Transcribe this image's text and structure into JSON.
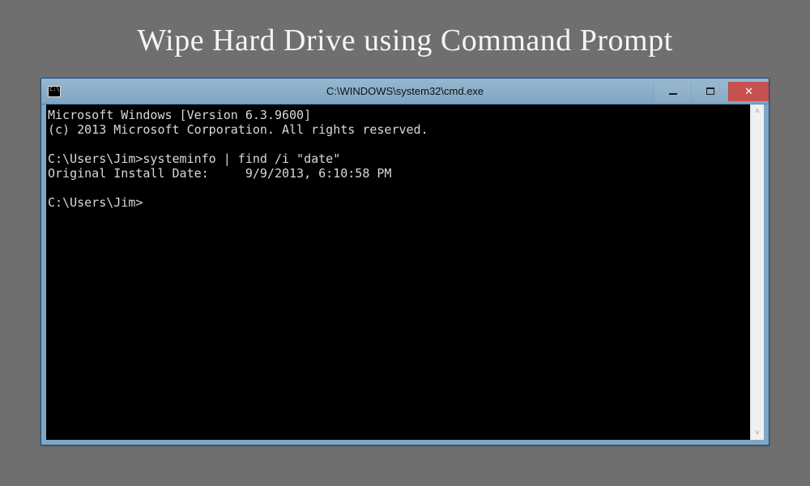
{
  "heading": "Wipe Hard Drive using Command Prompt",
  "window": {
    "title": "C:\\WINDOWS\\system32\\cmd.exe",
    "icon_name": "cmd-icon"
  },
  "controls": {
    "minimize_name": "minimize",
    "maximize_name": "maximize",
    "close_name": "close"
  },
  "terminal": {
    "lines": [
      "Microsoft Windows [Version 6.3.9600]",
      "(c) 2013 Microsoft Corporation. All rights reserved.",
      "",
      "C:\\Users\\Jim>systeminfo | find /i \"date\"",
      "Original Install Date:     9/9/2013, 6:10:58 PM",
      "",
      "C:\\Users\\Jim>"
    ]
  },
  "scrollbar": {
    "up_name": "scroll-up",
    "down_name": "scroll-down"
  },
  "colors": {
    "page_bg": "#6f6f6f",
    "titlebar_top": "#97b7cf",
    "titlebar_bottom": "#7fa6c4",
    "close_bg": "#c75050",
    "terminal_fg": "#d9d9d9"
  }
}
